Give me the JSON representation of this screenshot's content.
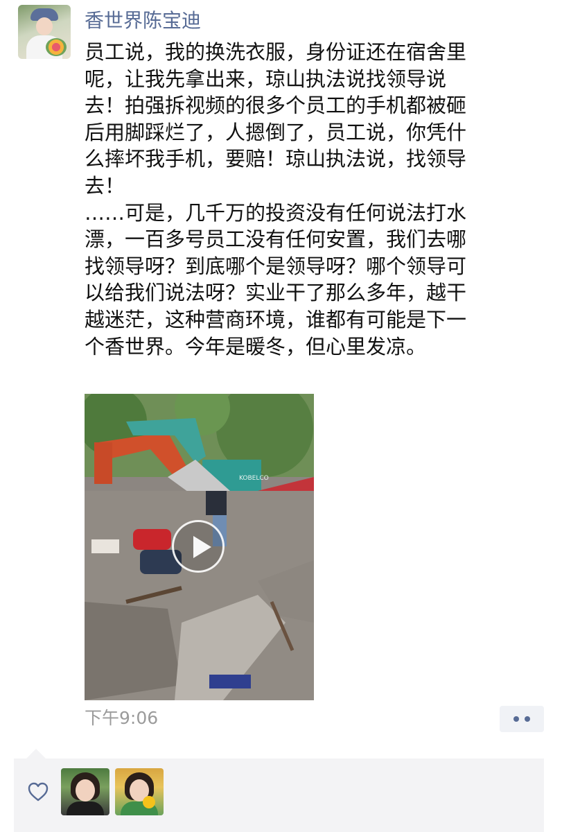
{
  "post": {
    "author": "香世界陈宝迪",
    "text": "员工说，我的换洗衣服，身份证还在宿舍里\n呢，让我先拿出来，琼山执法说找领导说\n去！拍强拆视频的很多个员工的手机都被砸\n后用脚踩烂了，人摁倒了，员工说，你凭什\n么摔坏我手机，要赔！琼山执法说，找领导\n去！\n……可是，几千万的投资没有任何说法打水\n漂，一百多号员工没有任何安置，我们去哪\n找领导呀？到底哪个是领导呀？哪个领导可\n以给我们说法呀？实业干了那么多年，越干\n越迷茫，这种营商环境，谁都有可能是下一\n个香世界。今年是暖冬，但心里发凉。",
    "time": "下午9:06",
    "video_watermark": "KOBELCO"
  },
  "icons": {
    "play": "play-icon",
    "more": "more-dots-icon",
    "like": "heart-icon"
  },
  "colors": {
    "link": "#576b95",
    "time": "#9b9b9b",
    "likes_bg": "#f3f3f5"
  }
}
